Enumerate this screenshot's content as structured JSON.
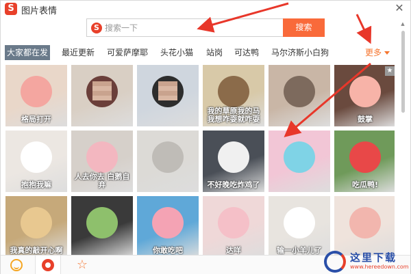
{
  "app": {
    "title": "图片表情",
    "logo_glyph": "S",
    "close_glyph": "✕"
  },
  "search": {
    "placeholder": "搜索一下",
    "value": "",
    "button_label": "搜索",
    "logo_glyph": "S"
  },
  "tabs": [
    {
      "label": "大家都在发",
      "active": true
    },
    {
      "label": "最近更新",
      "active": false
    },
    {
      "label": "可爱萨摩耶",
      "active": false
    },
    {
      "label": "头花小猫",
      "active": false
    },
    {
      "label": "站岗",
      "active": false
    },
    {
      "label": "可达鸭",
      "active": false
    },
    {
      "label": "马尔济斯小白狗",
      "active": false
    }
  ],
  "more": {
    "label": "更多"
  },
  "stickers": [
    {
      "name": "pink-bear-dancing",
      "caption": "格局打开",
      "bg": "#e9d7c9",
      "accent": "#f4a6a0"
    },
    {
      "name": "kid-peace-sign",
      "caption": "",
      "bg": "#d9cfc4",
      "accent": "#6b3f3a"
    },
    {
      "name": "boy-portrait",
      "caption": "",
      "bg": "#cfd6de",
      "accent": "#2d2d2d"
    },
    {
      "name": "cartoon-horse",
      "caption": "我的草原我的马 我想咋耍就咋耍",
      "bg": "#d8c9a8",
      "accent": "#8b6b4a"
    },
    {
      "name": "cat-claw",
      "caption": "",
      "bg": "#c9b6a6",
      "accent": "#7d6a5d"
    },
    {
      "name": "pink-bear-cheer",
      "caption": "鼓掌",
      "bg": "#6a4a3e",
      "accent": "#f7b3a8"
    },
    {
      "name": "white-bear-plush",
      "caption": "抱抱我嘛",
      "bg": "#ece7e2",
      "accent": "#ffffff"
    },
    {
      "name": "pink-pig-toy",
      "caption": "人去你去 白鹅自弃",
      "bg": "#d6d0ca",
      "accent": "#f3b7c0"
    },
    {
      "name": "kitten-desk",
      "caption": "",
      "bg": "#dcdad6",
      "accent": "#bfbcb7"
    },
    {
      "name": "chick-jack-o-lantern",
      "caption": "不好晚吃炸鸡了",
      "bg": "#4a4f57",
      "accent": "#f0f0f0"
    },
    {
      "name": "anime-girl-blue-hair",
      "caption": "",
      "bg": "#f2c6d6",
      "accent": "#7fd3e6"
    },
    {
      "name": "watermelon-duck",
      "caption": "吃瓜鸭!",
      "bg": "#6f9a5a",
      "accent": "#e84848"
    },
    {
      "name": "shiba-dog",
      "caption": "我真的敲开心啊",
      "bg": "#c6a97a",
      "accent": "#e8c890"
    },
    {
      "name": "black-dog-plate",
      "caption": "",
      "bg": "#3a3a3a",
      "accent": "#8ec06c"
    },
    {
      "name": "patrick-star",
      "caption": "你敢吃吧",
      "bg": "#5fa8d8",
      "accent": "#f4a3b4"
    },
    {
      "name": "pink-fox-plush",
      "caption": "达咩",
      "bg": "#efd8d8",
      "accent": "#f5c0c8"
    },
    {
      "name": "white-puppy",
      "caption": "输一小羊儿了",
      "bg": "#e8e4df",
      "accent": "#ffffff"
    },
    {
      "name": "pink-bear-sit",
      "caption": "",
      "bg": "#efe3dc",
      "accent": "#f2b6ae"
    }
  ],
  "bottom_bar": [
    {
      "icon": "smile-icon",
      "active": false
    },
    {
      "icon": "mascot-icon",
      "active": true
    },
    {
      "icon": "star-icon",
      "active": false
    }
  ],
  "watermark": {
    "text": "这里下载",
    "url": "www.hereedown.com"
  },
  "colors": {
    "accent": "#f96a3a",
    "active_tab": "#6a7a8a",
    "arrow": "#e8372a"
  }
}
